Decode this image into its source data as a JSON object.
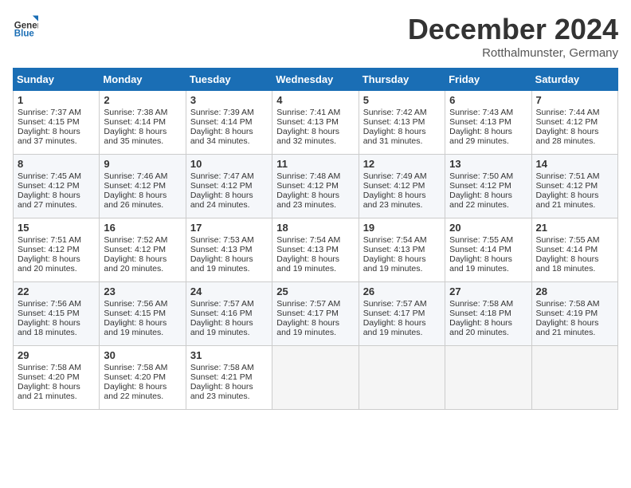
{
  "header": {
    "logo_line1": "General",
    "logo_line2": "Blue",
    "month": "December 2024",
    "location": "Rotthalmunster, Germany"
  },
  "days_of_week": [
    "Sunday",
    "Monday",
    "Tuesday",
    "Wednesday",
    "Thursday",
    "Friday",
    "Saturday"
  ],
  "weeks": [
    [
      {
        "day": "1",
        "sunrise": "Sunrise: 7:37 AM",
        "sunset": "Sunset: 4:15 PM",
        "daylight": "Daylight: 8 hours and 37 minutes."
      },
      {
        "day": "2",
        "sunrise": "Sunrise: 7:38 AM",
        "sunset": "Sunset: 4:14 PM",
        "daylight": "Daylight: 8 hours and 35 minutes."
      },
      {
        "day": "3",
        "sunrise": "Sunrise: 7:39 AM",
        "sunset": "Sunset: 4:14 PM",
        "daylight": "Daylight: 8 hours and 34 minutes."
      },
      {
        "day": "4",
        "sunrise": "Sunrise: 7:41 AM",
        "sunset": "Sunset: 4:13 PM",
        "daylight": "Daylight: 8 hours and 32 minutes."
      },
      {
        "day": "5",
        "sunrise": "Sunrise: 7:42 AM",
        "sunset": "Sunset: 4:13 PM",
        "daylight": "Daylight: 8 hours and 31 minutes."
      },
      {
        "day": "6",
        "sunrise": "Sunrise: 7:43 AM",
        "sunset": "Sunset: 4:13 PM",
        "daylight": "Daylight: 8 hours and 29 minutes."
      },
      {
        "day": "7",
        "sunrise": "Sunrise: 7:44 AM",
        "sunset": "Sunset: 4:12 PM",
        "daylight": "Daylight: 8 hours and 28 minutes."
      }
    ],
    [
      {
        "day": "8",
        "sunrise": "Sunrise: 7:45 AM",
        "sunset": "Sunset: 4:12 PM",
        "daylight": "Daylight: 8 hours and 27 minutes."
      },
      {
        "day": "9",
        "sunrise": "Sunrise: 7:46 AM",
        "sunset": "Sunset: 4:12 PM",
        "daylight": "Daylight: 8 hours and 26 minutes."
      },
      {
        "day": "10",
        "sunrise": "Sunrise: 7:47 AM",
        "sunset": "Sunset: 4:12 PM",
        "daylight": "Daylight: 8 hours and 24 minutes."
      },
      {
        "day": "11",
        "sunrise": "Sunrise: 7:48 AM",
        "sunset": "Sunset: 4:12 PM",
        "daylight": "Daylight: 8 hours and 23 minutes."
      },
      {
        "day": "12",
        "sunrise": "Sunrise: 7:49 AM",
        "sunset": "Sunset: 4:12 PM",
        "daylight": "Daylight: 8 hours and 23 minutes."
      },
      {
        "day": "13",
        "sunrise": "Sunrise: 7:50 AM",
        "sunset": "Sunset: 4:12 PM",
        "daylight": "Daylight: 8 hours and 22 minutes."
      },
      {
        "day": "14",
        "sunrise": "Sunrise: 7:51 AM",
        "sunset": "Sunset: 4:12 PM",
        "daylight": "Daylight: 8 hours and 21 minutes."
      }
    ],
    [
      {
        "day": "15",
        "sunrise": "Sunrise: 7:51 AM",
        "sunset": "Sunset: 4:12 PM",
        "daylight": "Daylight: 8 hours and 20 minutes."
      },
      {
        "day": "16",
        "sunrise": "Sunrise: 7:52 AM",
        "sunset": "Sunset: 4:12 PM",
        "daylight": "Daylight: 8 hours and 20 minutes."
      },
      {
        "day": "17",
        "sunrise": "Sunrise: 7:53 AM",
        "sunset": "Sunset: 4:13 PM",
        "daylight": "Daylight: 8 hours and 19 minutes."
      },
      {
        "day": "18",
        "sunrise": "Sunrise: 7:54 AM",
        "sunset": "Sunset: 4:13 PM",
        "daylight": "Daylight: 8 hours and 19 minutes."
      },
      {
        "day": "19",
        "sunrise": "Sunrise: 7:54 AM",
        "sunset": "Sunset: 4:13 PM",
        "daylight": "Daylight: 8 hours and 19 minutes."
      },
      {
        "day": "20",
        "sunrise": "Sunrise: 7:55 AM",
        "sunset": "Sunset: 4:14 PM",
        "daylight": "Daylight: 8 hours and 19 minutes."
      },
      {
        "day": "21",
        "sunrise": "Sunrise: 7:55 AM",
        "sunset": "Sunset: 4:14 PM",
        "daylight": "Daylight: 8 hours and 18 minutes."
      }
    ],
    [
      {
        "day": "22",
        "sunrise": "Sunrise: 7:56 AM",
        "sunset": "Sunset: 4:15 PM",
        "daylight": "Daylight: 8 hours and 18 minutes."
      },
      {
        "day": "23",
        "sunrise": "Sunrise: 7:56 AM",
        "sunset": "Sunset: 4:15 PM",
        "daylight": "Daylight: 8 hours and 19 minutes."
      },
      {
        "day": "24",
        "sunrise": "Sunrise: 7:57 AM",
        "sunset": "Sunset: 4:16 PM",
        "daylight": "Daylight: 8 hours and 19 minutes."
      },
      {
        "day": "25",
        "sunrise": "Sunrise: 7:57 AM",
        "sunset": "Sunset: 4:17 PM",
        "daylight": "Daylight: 8 hours and 19 minutes."
      },
      {
        "day": "26",
        "sunrise": "Sunrise: 7:57 AM",
        "sunset": "Sunset: 4:17 PM",
        "daylight": "Daylight: 8 hours and 19 minutes."
      },
      {
        "day": "27",
        "sunrise": "Sunrise: 7:58 AM",
        "sunset": "Sunset: 4:18 PM",
        "daylight": "Daylight: 8 hours and 20 minutes."
      },
      {
        "day": "28",
        "sunrise": "Sunrise: 7:58 AM",
        "sunset": "Sunset: 4:19 PM",
        "daylight": "Daylight: 8 hours and 21 minutes."
      }
    ],
    [
      {
        "day": "29",
        "sunrise": "Sunrise: 7:58 AM",
        "sunset": "Sunset: 4:20 PM",
        "daylight": "Daylight: 8 hours and 21 minutes."
      },
      {
        "day": "30",
        "sunrise": "Sunrise: 7:58 AM",
        "sunset": "Sunset: 4:20 PM",
        "daylight": "Daylight: 8 hours and 22 minutes."
      },
      {
        "day": "31",
        "sunrise": "Sunrise: 7:58 AM",
        "sunset": "Sunset: 4:21 PM",
        "daylight": "Daylight: 8 hours and 23 minutes."
      },
      null,
      null,
      null,
      null
    ]
  ]
}
